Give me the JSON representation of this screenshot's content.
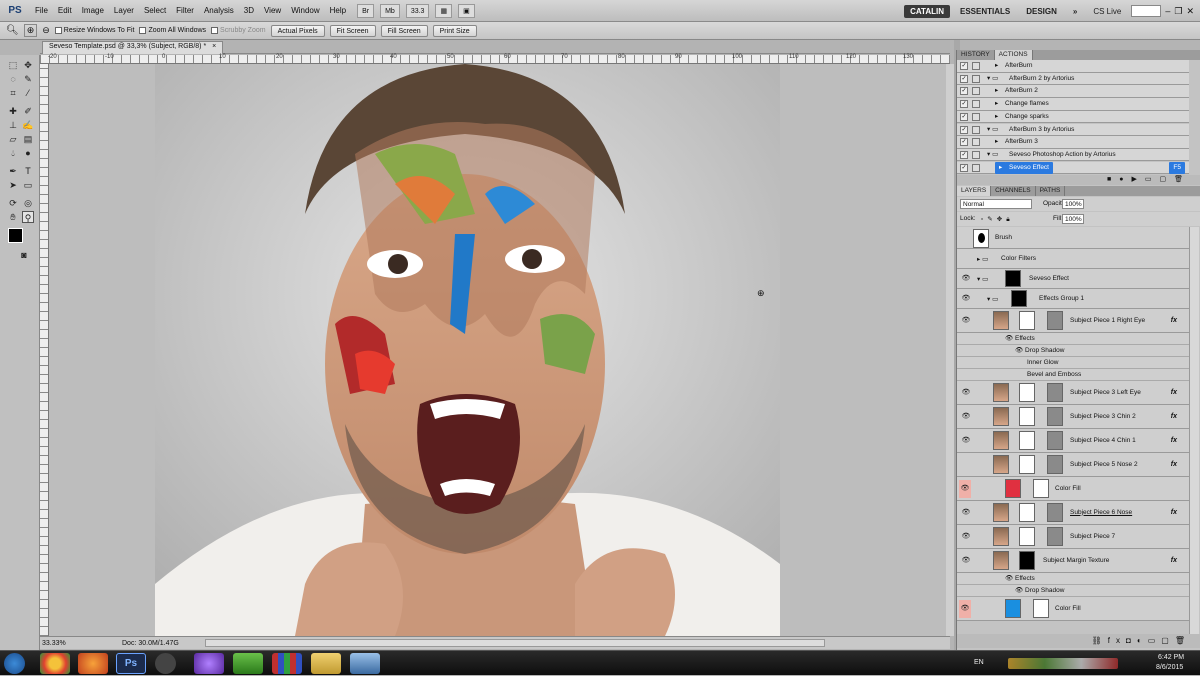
{
  "menubar": {
    "app_logo": "PS",
    "menus": [
      "File",
      "Edit",
      "Image",
      "Layer",
      "Select",
      "Filter",
      "Analysis",
      "3D",
      "View",
      "Window",
      "Help"
    ],
    "zoom": "33.3",
    "workspaces": [
      "CATALIN",
      "ESSENTIALS",
      "DESIGN"
    ],
    "more": "»",
    "cs_live": "CS Live"
  },
  "options": {
    "resize_windows": "Resize Windows To Fit",
    "zoom_all": "Zoom All Windows",
    "scrubby": "Scrubby Zoom",
    "buttons": [
      "Actual Pixels",
      "Fit Screen",
      "Fill Screen",
      "Print Size"
    ]
  },
  "document": {
    "tab": "Seveso Template.psd @ 33,3% (Subject, RGB/8) *",
    "close": "×",
    "ruler_marks": [
      "-20",
      "-10",
      "0",
      "10",
      "20",
      "30",
      "40",
      "50",
      "60",
      "70",
      "80",
      "90",
      "100",
      "110",
      "120",
      "130"
    ],
    "status_zoom": "33.33%",
    "status_doc": "Doc: 30.0M/1.47G"
  },
  "colors": {
    "selection": "#2b7ae0",
    "color_fill_red": "#e03040",
    "color_fill_blue": "#1a8fe0",
    "row_highlight": "#f0b0a8"
  },
  "actions": {
    "tabs": [
      "HISTORY",
      "ACTIONS"
    ],
    "rows": [
      {
        "label": "AfterBurn",
        "indent": 1
      },
      {
        "label": "AfterBurn 2 by Artorius",
        "indent": 0,
        "folder": true
      },
      {
        "label": "AfterBurn 2",
        "indent": 1
      },
      {
        "label": "Change flames",
        "indent": 1
      },
      {
        "label": "Change sparks",
        "indent": 1
      },
      {
        "label": "AfterBurn 3 by Artorius",
        "indent": 0,
        "folder": true
      },
      {
        "label": "AfterBurn 3",
        "indent": 1
      },
      {
        "label": "Seveso Photoshop Action by Artorius",
        "indent": 0,
        "folder": true
      },
      {
        "label": "Seveso Effect",
        "indent": 1,
        "selected": true,
        "shortcut": "F5"
      }
    ]
  },
  "layers": {
    "tabs": [
      "LAYERS",
      "CHANNELS",
      "PATHS"
    ],
    "blend_mode": "Normal",
    "opacity_label": "Opacity:",
    "opacity": "100%",
    "lock_label": "Lock:",
    "fill_label": "Fill:",
    "fill": "100%",
    "items": [
      {
        "name": "Brush",
        "type": "layer"
      },
      {
        "name": "Color Filters",
        "type": "group"
      },
      {
        "name": "Seveso Effect",
        "type": "group"
      },
      {
        "name": "Effects Group 1",
        "type": "group"
      },
      {
        "name": "Subject Piece 1 Right Eye",
        "type": "layer",
        "fx": true
      },
      {
        "name": "Effects",
        "type": "effect"
      },
      {
        "name": "Drop Shadow",
        "type": "effect"
      },
      {
        "name": "Inner Glow",
        "type": "effect"
      },
      {
        "name": "Bevel and Emboss",
        "type": "effect"
      },
      {
        "name": "Subject Piece 3 Left Eye",
        "type": "layer",
        "fx": true
      },
      {
        "name": "Subject Piece 3 Chin 2",
        "type": "layer",
        "fx": true
      },
      {
        "name": "Subject Piece 4 Chin 1",
        "type": "layer",
        "fx": true
      },
      {
        "name": "Subject Piece 5 Nose 2",
        "type": "layer",
        "fx": true
      },
      {
        "name": "Color Fill",
        "type": "fill"
      },
      {
        "name": "Subject Piece 6 Nose",
        "type": "layer",
        "fx": true
      },
      {
        "name": "Subject Piece 7",
        "type": "layer"
      },
      {
        "name": "Subject Margin Texture",
        "type": "layer",
        "fx": true
      },
      {
        "name": "Effects",
        "type": "effect"
      },
      {
        "name": "Drop Shadow",
        "type": "effect"
      },
      {
        "name": "Color Fill",
        "type": "fill"
      }
    ],
    "fx_label": "fx"
  },
  "taskbar": {
    "lang": "EN",
    "time": "6:42 PM",
    "date": "8/6/2015",
    "app_ps": "Ps"
  }
}
